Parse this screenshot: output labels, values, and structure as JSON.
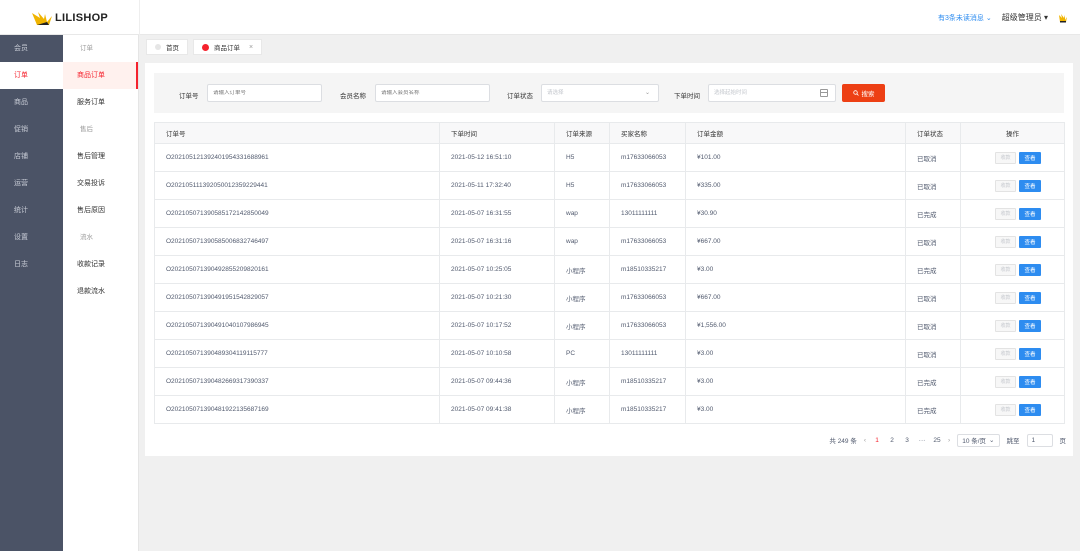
{
  "brand": {
    "name": "LILISHOP"
  },
  "header": {
    "message_link": "有3条未读消息",
    "admin_name": "超级管理员"
  },
  "nav_main": [
    "会员",
    "订单",
    "商品",
    "促销",
    "店铺",
    "运营",
    "统计",
    "设置",
    "日志"
  ],
  "nav_main_active": 1,
  "nav_sub": [
    {
      "label": "订单",
      "group": true
    },
    {
      "label": "商品订单",
      "active": true
    },
    {
      "label": "服务订单"
    },
    {
      "label": "售后",
      "group": true
    },
    {
      "label": "售后管理"
    },
    {
      "label": "交易投诉"
    },
    {
      "label": "售后原因"
    },
    {
      "label": "流水",
      "group": true
    },
    {
      "label": "收款记录"
    },
    {
      "label": "退款流水"
    }
  ],
  "tabs": [
    {
      "label": "首页"
    },
    {
      "label": "商品订单",
      "active": true
    }
  ],
  "filter": {
    "order_no_label": "订单号",
    "order_no_placeholder": "请输入订单号",
    "member_label": "会员名称",
    "member_placeholder": "请输入会员名称",
    "status_label": "订单状态",
    "status_placeholder": "请选择",
    "time_label": "下单时间",
    "time_placeholder": "选择起始时间",
    "search_button": "搜索"
  },
  "table": {
    "columns": [
      "订单号",
      "下单时间",
      "订单来源",
      "买家名称",
      "订单金额",
      "订单状态",
      "操作"
    ],
    "pay_label": "收款",
    "view_label": "查看",
    "rows": [
      [
        "O202105121392401954331688961",
        "2021-05-12 16:51:10",
        "H5",
        "m17633066053",
        "¥101.00",
        "已取消"
      ],
      [
        "O202105111392050012359229441",
        "2021-05-11 17:32:40",
        "H5",
        "m17633066053",
        "¥335.00",
        "已取消"
      ],
      [
        "O202105071390585172142850049",
        "2021-05-07 16:31:55",
        "wap",
        "13011111111",
        "¥30.90",
        "已完成"
      ],
      [
        "O202105071390585006832746497",
        "2021-05-07 16:31:16",
        "wap",
        "m17633066053",
        "¥667.00",
        "已取消"
      ],
      [
        "O202105071390492855209820161",
        "2021-05-07 10:25:05",
        "小程序",
        "m18510335217",
        "¥3.00",
        "已完成"
      ],
      [
        "O202105071390491951542829057",
        "2021-05-07 10:21:30",
        "小程序",
        "m17633066053",
        "¥667.00",
        "已取消"
      ],
      [
        "O202105071390491040107986945",
        "2021-05-07 10:17:52",
        "小程序",
        "m17633066053",
        "¥1,556.00",
        "已取消"
      ],
      [
        "O202105071390489304119115777",
        "2021-05-07 10:10:58",
        "PC",
        "13011111111",
        "¥3.00",
        "已取消"
      ],
      [
        "O202105071390482669317390337",
        "2021-05-07 09:44:36",
        "小程序",
        "m18510335217",
        "¥3.00",
        "已完成"
      ],
      [
        "O202105071390481922135687169",
        "2021-05-07 09:41:38",
        "小程序",
        "m18510335217",
        "¥3.00",
        "已完成"
      ]
    ]
  },
  "pagination": {
    "total_text": "共 249 条",
    "pages": [
      "1",
      "2",
      "3",
      "···",
      "25"
    ],
    "current": "1",
    "page_size": "10 条/页",
    "jump_label": "跳至",
    "jump_value": "1",
    "page_suffix": "页"
  },
  "colors": {
    "accent": "#f5222d",
    "primary": "#2d8cf0",
    "sidebar": "#4b5366",
    "search_button": "#ed3f14"
  }
}
